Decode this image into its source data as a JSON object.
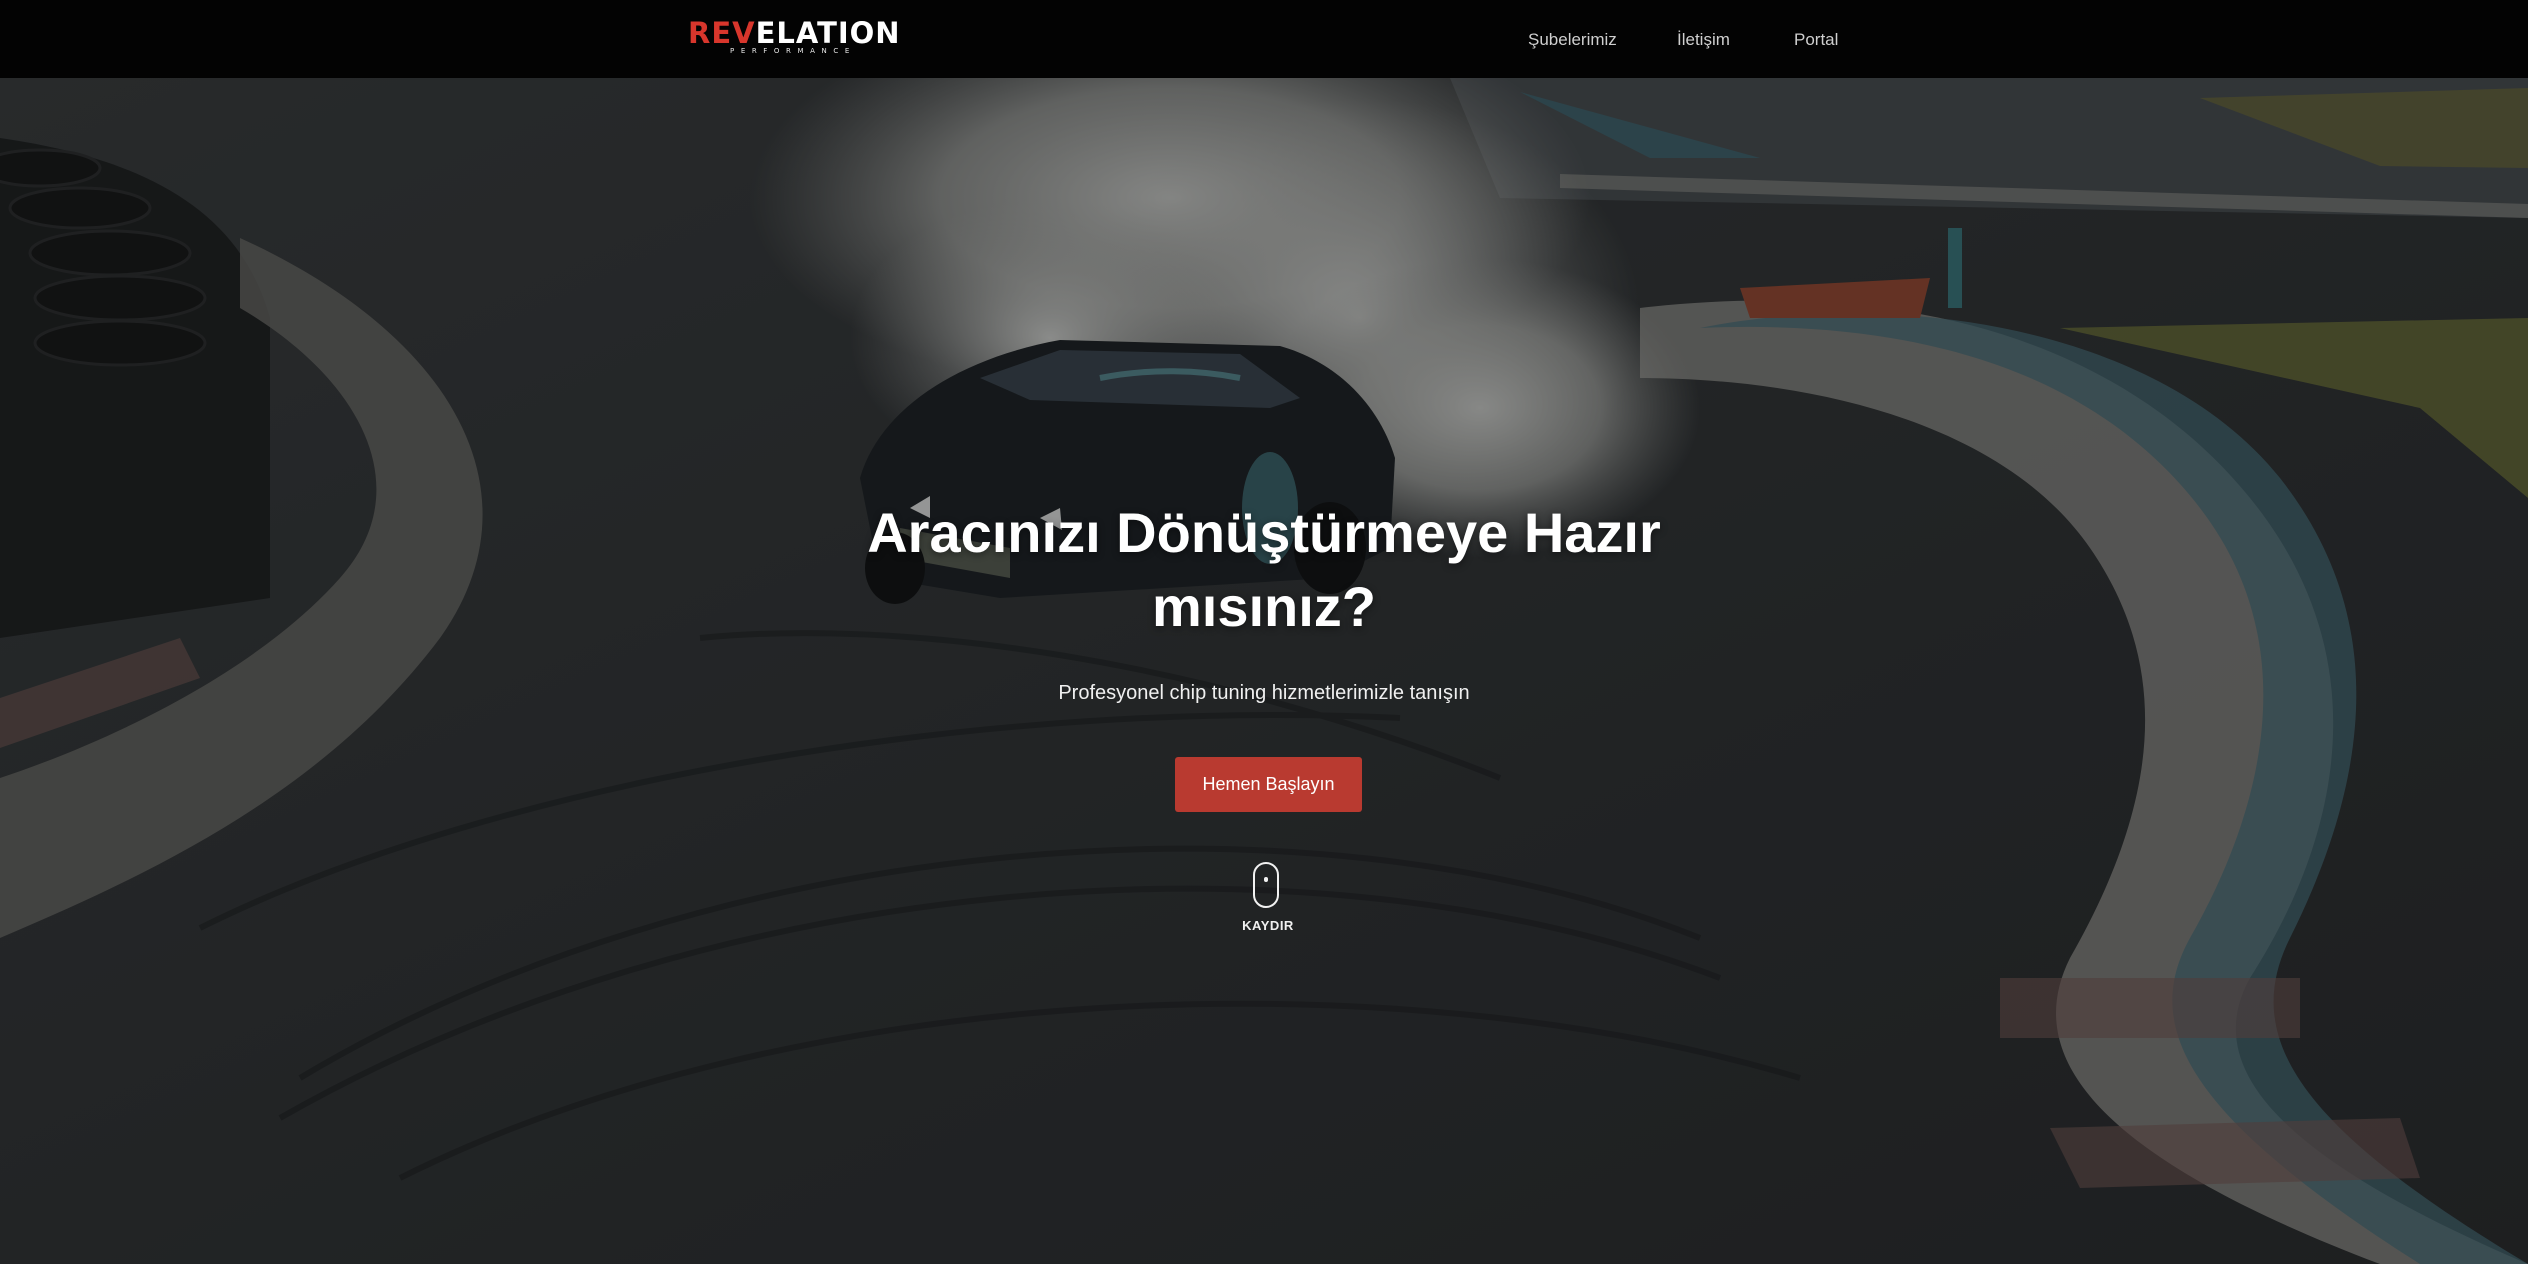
{
  "brand": {
    "logo_red_part": "REV",
    "logo_white_part": "ELATION",
    "logo_subtitle": "PERFORMANCE",
    "accent_color": "#d8362c"
  },
  "nav": {
    "items": [
      {
        "label": "Şubelerimiz"
      },
      {
        "label": "İletişim"
      },
      {
        "label": "Portal"
      }
    ]
  },
  "hero": {
    "background": "drift car with tire smoke on a race track",
    "title": "Aracınızı Dönüştürmeye Hazır mısınız?",
    "subtitle": "Profesyonel chip tuning hizmetlerimizle tanışın",
    "cta_label": "Hemen Başlayın",
    "cta_color": "#b93a30",
    "scroll_icon": "mouse-scroll-icon",
    "scroll_label": "KAYDIR"
  }
}
